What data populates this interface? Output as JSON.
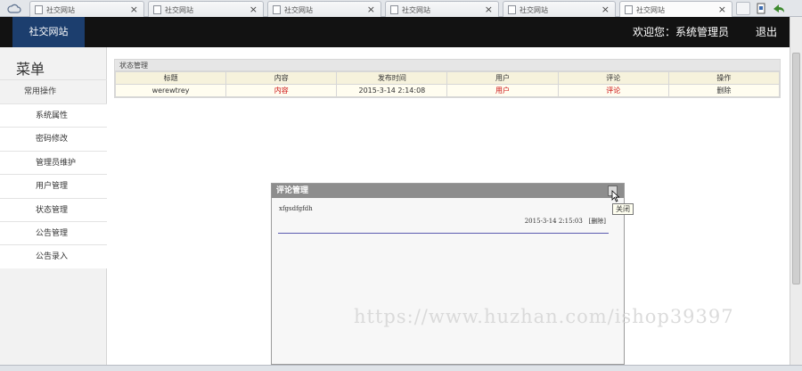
{
  "browser": {
    "tabs": [
      {
        "label": "社交网站",
        "close": "×"
      },
      {
        "label": "社交网站",
        "close": "×"
      },
      {
        "label": "社交网站",
        "close": "×"
      },
      {
        "label": "社交网站",
        "close": "×"
      },
      {
        "label": "社交网站",
        "close": "×"
      },
      {
        "label": "社交网站",
        "close": "×"
      }
    ]
  },
  "header": {
    "brand": "社交网站",
    "welcome": "欢迎您：系统管理员",
    "logout": "退出"
  },
  "sidebar": {
    "title": "菜单",
    "group": "常用操作",
    "items": [
      "系统属性",
      "密码修改",
      "管理员维护",
      "用户管理",
      "状态管理",
      "公告管理",
      "公告录入"
    ]
  },
  "status_panel": {
    "title": "状态管理",
    "columns": [
      "标题",
      "内容",
      "发布时间",
      "用户",
      "评论",
      "操作"
    ],
    "rows": [
      {
        "title": "werewtrey",
        "content": "内容",
        "time": "2015-3-14 2:14:08",
        "user": "用户",
        "comment": "评论",
        "action": "删除"
      }
    ]
  },
  "comment_dialog": {
    "title": "评论管理",
    "comment_text": "xfgsdfgfdh",
    "comment_time": "2015-3-14 2:15:03",
    "delete_label": "[删除]",
    "close_tooltip": "关闭"
  },
  "watermark": "https://www.huzhan.com/ishop39397",
  "colors": {
    "header_bg": "#121212",
    "brand_bg": "#1c3e6e",
    "link_red": "#cc1111",
    "dialog_title_bg": "#8d8d8d"
  }
}
